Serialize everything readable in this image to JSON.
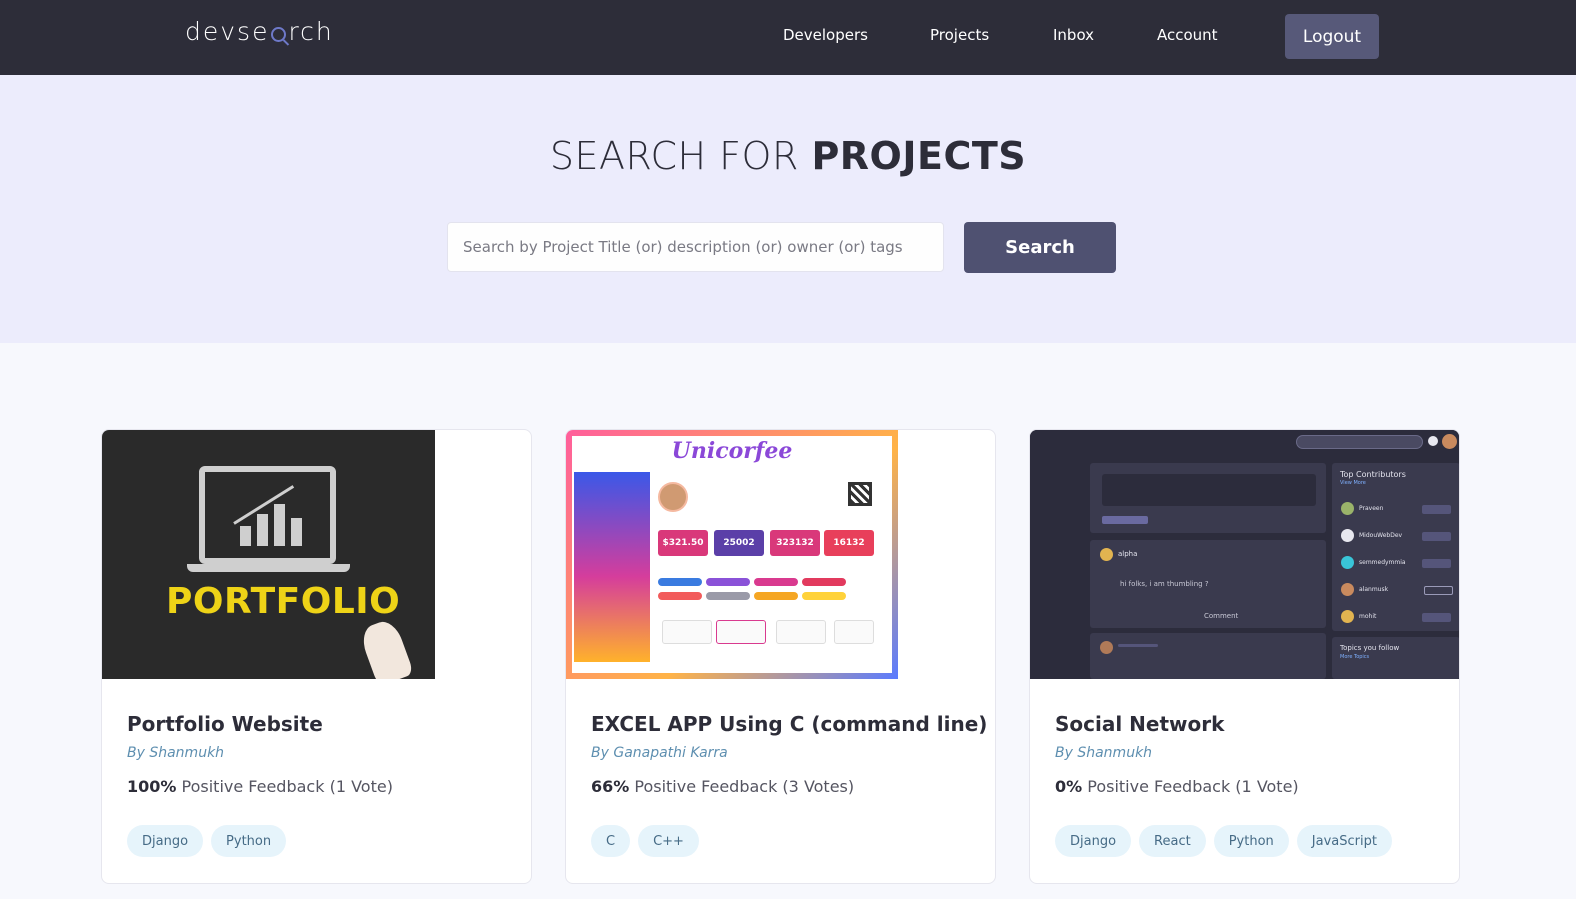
{
  "header": {
    "logo": {
      "prefix": "devse",
      "suffix": "rch"
    },
    "nav": [
      "Developers",
      "Projects",
      "Inbox",
      "Account"
    ],
    "logout_label": "Logout"
  },
  "hero": {
    "title_light": "SEARCH FOR ",
    "title_bold": "PROJECTS",
    "search_placeholder": "Search by Project Title (or) description (or) owner (or) tags",
    "search_value": "",
    "search_button": "Search"
  },
  "projects": [
    {
      "title": "Portfolio Website",
      "author": "By Shanmukh",
      "feedback_percent": "100%",
      "feedback_text": " Positive Feedback (1 Vote)",
      "tags": [
        "Django",
        "Python"
      ],
      "image": {
        "text": "PORTFOLIO"
      }
    },
    {
      "title": "EXCEL APP Using C (command line)",
      "author": "By Ganapathi Karra",
      "feedback_percent": "66%",
      "feedback_text": " Positive Feedback (3 Votes)",
      "tags": [
        "C",
        "C++"
      ],
      "image": {
        "brand": "Unicorfee",
        "stats": [
          "$321.50",
          "25002",
          "323132",
          "16132"
        ]
      }
    },
    {
      "title": "Social Network",
      "author": "By Shanmukh",
      "feedback_percent": "0%",
      "feedback_text": " Positive Feedback (1 Vote)",
      "tags": [
        "Django",
        "React",
        "Python",
        "JavaScript"
      ],
      "image": {
        "contributors_title": "Top Contributors",
        "view_more": "View More",
        "contributors": [
          "Praveen",
          "MidouWebDev",
          "semmedymmia",
          "alanmusk",
          "mohit"
        ],
        "topics_title": "Topics you follow",
        "more_topics": "More Topics",
        "post_user": "alpha",
        "post_text": "hi folks, i am thumbling ?",
        "comment_label": "Comment"
      }
    }
  ],
  "colors": {
    "header_bg": "#2d2d39",
    "hero_bg": "#ececfc",
    "button": "#4f5171",
    "tag_bg": "#e6f4fb",
    "author": "#5e8fb0"
  }
}
